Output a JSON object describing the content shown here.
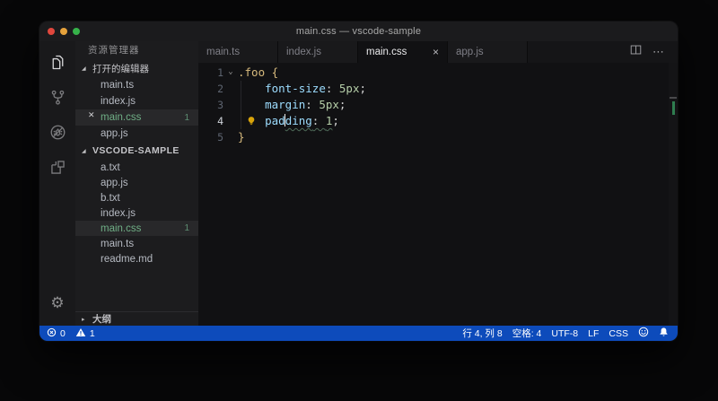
{
  "window": {
    "title": "main.css — vscode-sample"
  },
  "activity_bar": {
    "items": [
      {
        "id": "explorer",
        "icon": "files-icon",
        "active": true
      },
      {
        "id": "source-control",
        "icon": "git-fork-icon",
        "active": false
      },
      {
        "id": "debug",
        "icon": "debug-disabled-icon",
        "active": false
      },
      {
        "id": "extensions",
        "icon": "extensions-icon",
        "active": false
      }
    ],
    "settings_icon": "gear-icon",
    "settings_glyph": "⚙"
  },
  "sidebar": {
    "title": "资源管理器",
    "open_editors": {
      "label": "打开的编辑器",
      "items": [
        {
          "name": "main.ts"
        },
        {
          "name": "index.js"
        },
        {
          "name": "main.css",
          "badge": "1",
          "selected": true
        },
        {
          "name": "app.js"
        }
      ]
    },
    "folder": {
      "label": "VSCODE-SAMPLE",
      "items": [
        {
          "name": "a.txt"
        },
        {
          "name": "app.js"
        },
        {
          "name": "b.txt"
        },
        {
          "name": "index.js"
        },
        {
          "name": "main.css",
          "badge": "1",
          "selected": true
        },
        {
          "name": "main.ts"
        },
        {
          "name": "readme.md"
        }
      ]
    },
    "outline": {
      "label": "大纲"
    }
  },
  "tabs": [
    {
      "label": "main.ts"
    },
    {
      "label": "index.js"
    },
    {
      "label": "main.css",
      "active": true,
      "close": "×"
    },
    {
      "label": "app.js"
    }
  ],
  "editor": {
    "lines": [
      {
        "num": "1",
        "tokens": [
          {
            "t": ".foo",
            "c": "sel"
          },
          {
            "t": " {",
            "c": "brace"
          }
        ]
      },
      {
        "num": "2",
        "tokens": [
          {
            "t": "    ",
            "c": "ws"
          },
          {
            "t": "font-size",
            "c": "prop"
          },
          {
            "t": ": ",
            "c": "punct"
          },
          {
            "t": "5px",
            "c": "num"
          },
          {
            "t": ";",
            "c": "punct"
          }
        ]
      },
      {
        "num": "3",
        "tokens": [
          {
            "t": "    ",
            "c": "ws"
          },
          {
            "t": "margin",
            "c": "prop"
          },
          {
            "t": ": ",
            "c": "punct"
          },
          {
            "t": "5px",
            "c": "num"
          },
          {
            "t": ";",
            "c": "punct"
          }
        ]
      },
      {
        "num": "4",
        "tokens": [
          {
            "t": "    ",
            "c": "ws"
          },
          {
            "t": "pad",
            "c": "prop"
          },
          {
            "t": "ding",
            "c": "prop sq"
          },
          {
            "t": ": ",
            "c": "punct sq"
          },
          {
            "t": "1",
            "c": "num sq"
          },
          {
            "t": ";",
            "c": "punct"
          }
        ]
      },
      {
        "num": "5",
        "tokens": [
          {
            "t": "}",
            "c": "brace"
          }
        ]
      }
    ]
  },
  "status_bar": {
    "errors": "0",
    "warnings": "1",
    "cursor_position": "行 4, 列 8",
    "indentation": "空格: 4",
    "encoding": "UTF-8",
    "eol": "LF",
    "language": "CSS"
  },
  "glyphs": {
    "twistie_open": "◢",
    "twistie_collapsed": "▸",
    "close": "✕",
    "fold_open": "⌄",
    "more_actions": "⋯"
  },
  "colors": {
    "status_bar": "#0d4bbb",
    "untracked_green": "#6fae85",
    "selector_gold": "#d7ba7d",
    "property_blue": "#9cdcfe",
    "value_green": "#b5cea8",
    "lightbulb": "#d9a40a",
    "traffic_red": "#e0473d",
    "traffic_yellow": "#e6a23c",
    "traffic_green": "#36b24a"
  }
}
